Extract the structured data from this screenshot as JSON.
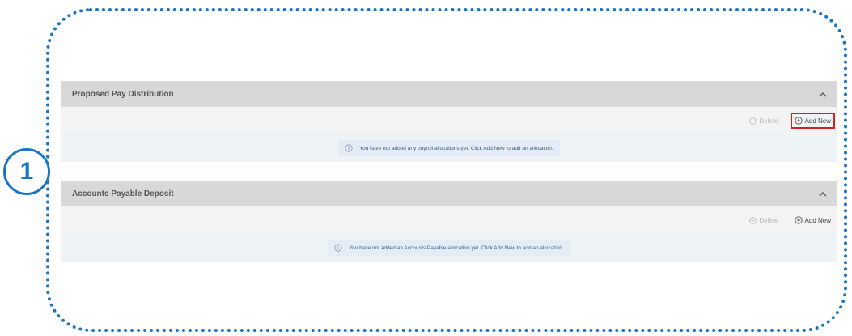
{
  "callout": {
    "step_number": "1",
    "accent_color": "#1976c7",
    "highlight_color": "#d32020"
  },
  "sections": [
    {
      "title": "Proposed Pay Distribution",
      "delete_label": "Delete",
      "add_label": "Add New",
      "message": "You have not added any payroll allocations yet. Click Add New to add an allocation."
    },
    {
      "title": "Accounts Payable Deposit",
      "delete_label": "Delete",
      "add_label": "Add New",
      "message": "You have not added an Accounts Payable allocation yet. Click Add New to add an allocation."
    }
  ],
  "icons": {
    "collapse": "chevron-up-icon",
    "delete": "minus-circle-icon",
    "add": "plus-circle-icon",
    "info": "info-circle-icon"
  }
}
